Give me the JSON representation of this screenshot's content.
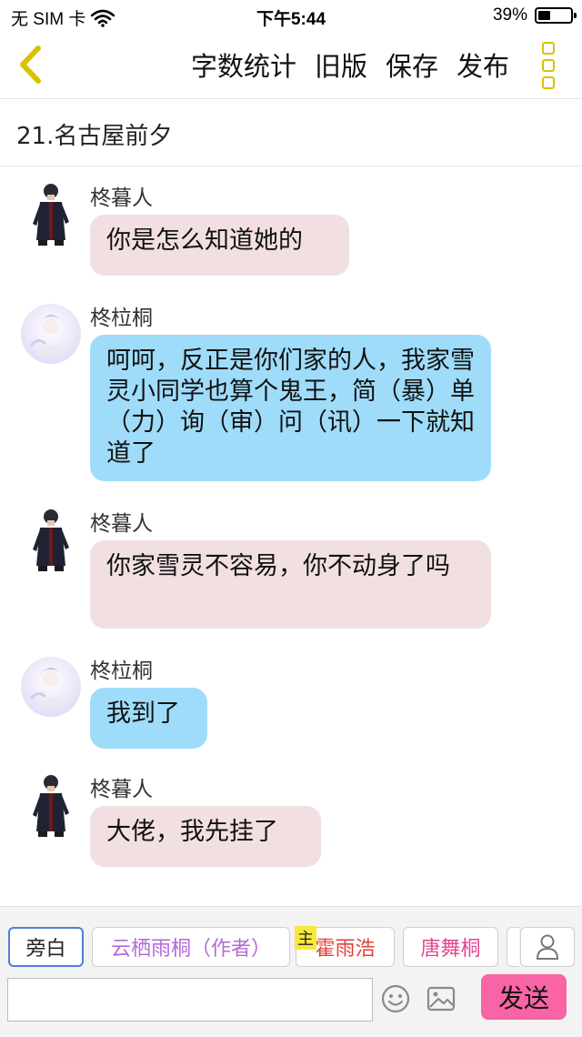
{
  "status_bar": {
    "carrier": "无 SIM 卡",
    "time": "下午5:44",
    "battery_percent": "39%",
    "battery_level": 0.39
  },
  "nav": {
    "back_icon": "chevron-left-icon",
    "actions": [
      "字数统计",
      "旧版",
      "保存",
      "发布"
    ],
    "more_icon": "vertical-dots-icon"
  },
  "chapter_title": "21.名古屋前夕",
  "messages": [
    {
      "sender": "柊暮人",
      "text": "你是怎么知道她的",
      "color": "#f2dfe1"
    },
    {
      "sender": "柊柆桐",
      "text": "呵呵，反正是你们家的人，我家雪灵小同学也算个鬼王，简（暴）单（力）询（审）问（讯）一下就知道了",
      "color": "#9fdcfa"
    },
    {
      "sender": "柊暮人",
      "text": "你家雪灵不容易，你不动身了吗",
      "color": "#f2dfe1"
    },
    {
      "sender": "柊柆桐",
      "text": "我到了",
      "color": "#9fdcfa"
    },
    {
      "sender": "柊暮人",
      "text": "大佬，我先挂了",
      "color": "#f2dfe1"
    }
  ],
  "roles": [
    {
      "label": "旁白",
      "color": "#222222",
      "selected": true
    },
    {
      "label": "云栖雨桐（作者）",
      "color": "#b46bd6"
    },
    {
      "label": "霍雨浩",
      "color": "#e0413a",
      "tag": "主"
    },
    {
      "label": "唐舞桐",
      "color": "#e44690"
    }
  ],
  "composer": {
    "input_value": "",
    "emoji_icon": "smiley-icon",
    "image_icon": "image-icon",
    "send_label": "发送",
    "send_color": "#f864a6"
  }
}
